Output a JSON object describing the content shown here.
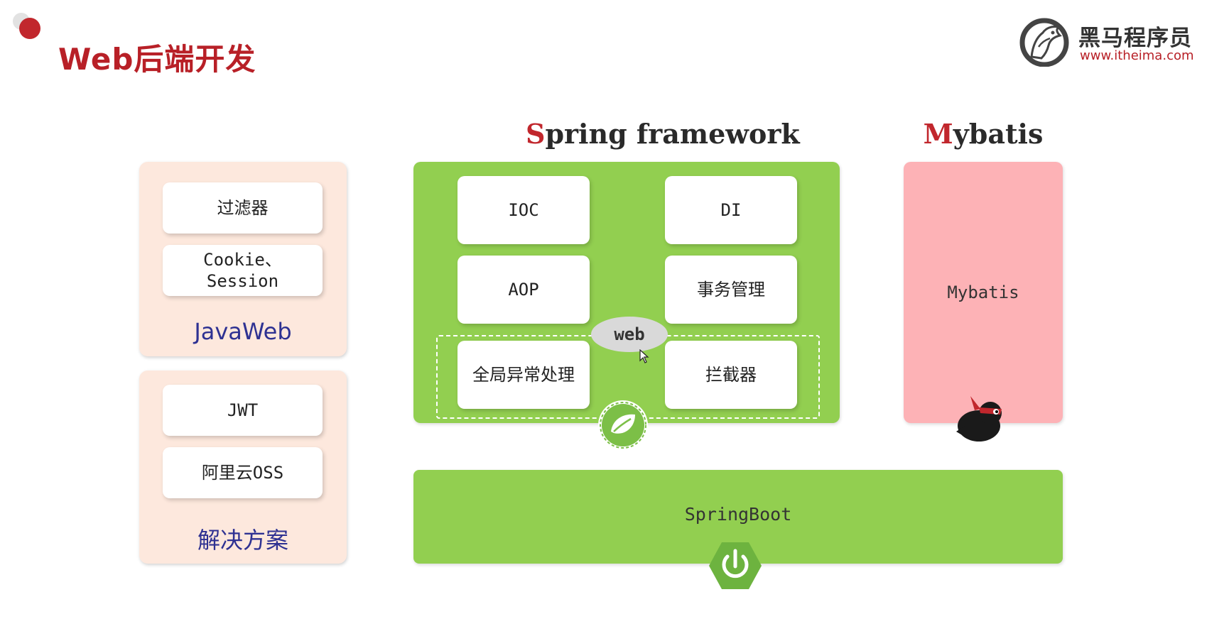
{
  "header": {
    "title": "Web后端开发",
    "brand_name": "黑马程序员",
    "brand_url": "www.itheima.com",
    "brand_icon": "horse-logo-icon"
  },
  "javaweb": {
    "items": [
      "过滤器",
      "Cookie、\nSession"
    ],
    "caption": "JavaWeb"
  },
  "solutions": {
    "items": [
      "JWT",
      "阿里云OSS"
    ],
    "caption": "解决方案"
  },
  "spring": {
    "heading_first": "S",
    "heading_rest": "pring framework",
    "cells": [
      "IOC",
      "DI",
      "AOP",
      "事务管理",
      "全局异常处理",
      "拦截器"
    ],
    "web_label": "web",
    "icon": "spring-leaf-icon"
  },
  "mybatis": {
    "heading_first": "M",
    "heading_rest": "ybatis",
    "label": "Mybatis",
    "icon": "mybatis-bird-icon"
  },
  "springboot": {
    "label": "SpringBoot",
    "icon": "power-icon"
  },
  "colors": {
    "accent_red": "#c1272d",
    "spring_green": "#92cf50",
    "javaweb_bg": "#fde8dd",
    "mybatis_pink": "#fdb2b6",
    "caption_blue": "#2e3192"
  }
}
